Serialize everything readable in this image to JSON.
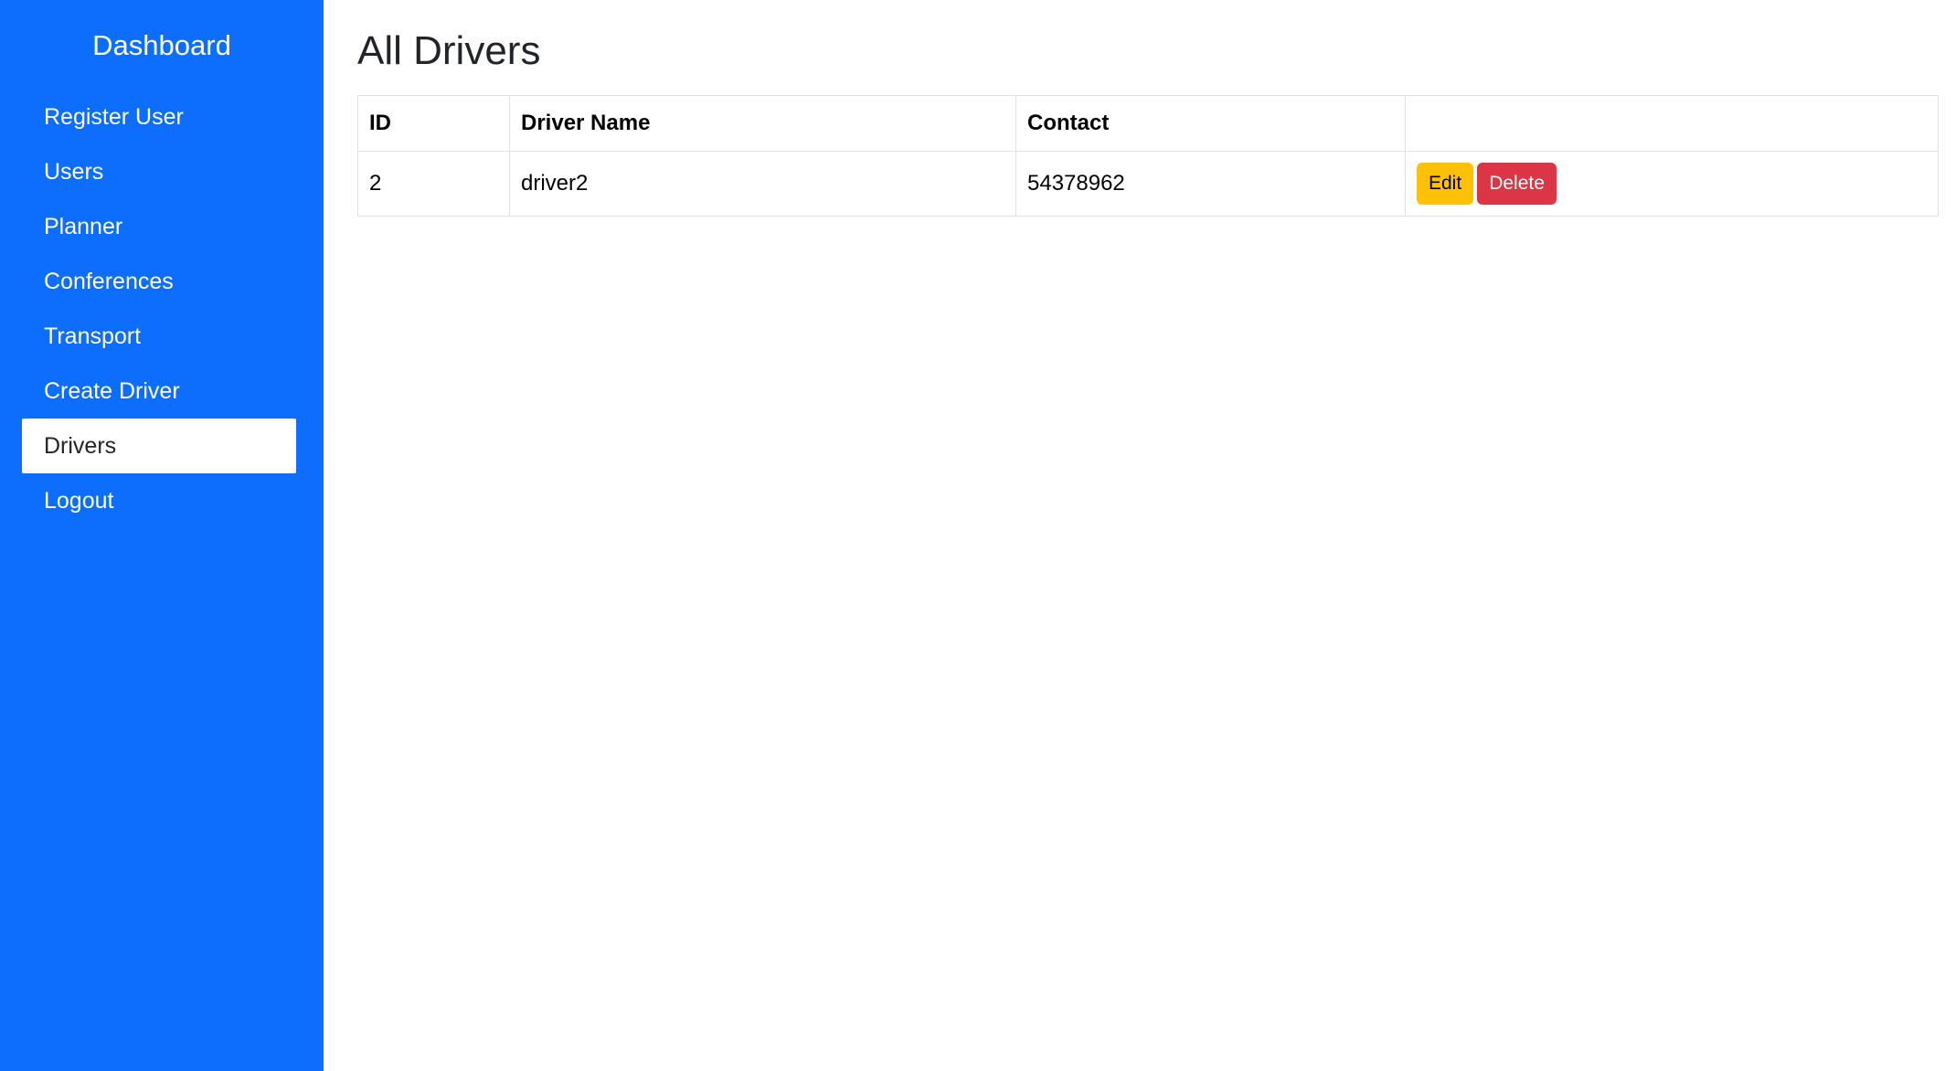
{
  "sidebar": {
    "brand": "Dashboard",
    "items": [
      {
        "label": "Register User"
      },
      {
        "label": "Users"
      },
      {
        "label": "Planner"
      },
      {
        "label": "Conferences"
      },
      {
        "label": "Transport"
      },
      {
        "label": "Create Driver"
      },
      {
        "label": "Drivers",
        "active": true
      },
      {
        "label": "Logout"
      }
    ]
  },
  "main": {
    "title": "All Drivers",
    "table": {
      "headers": [
        "ID",
        "Driver Name",
        "Contact",
        ""
      ],
      "rows": [
        {
          "id": "2",
          "name": "driver2",
          "contact": "54378962",
          "edit_label": "Edit",
          "delete_label": "Delete"
        }
      ]
    }
  },
  "colors": {
    "sidebar_bg": "#0d6efd",
    "edit_button": "#ffc107",
    "delete_button": "#dc3545"
  }
}
